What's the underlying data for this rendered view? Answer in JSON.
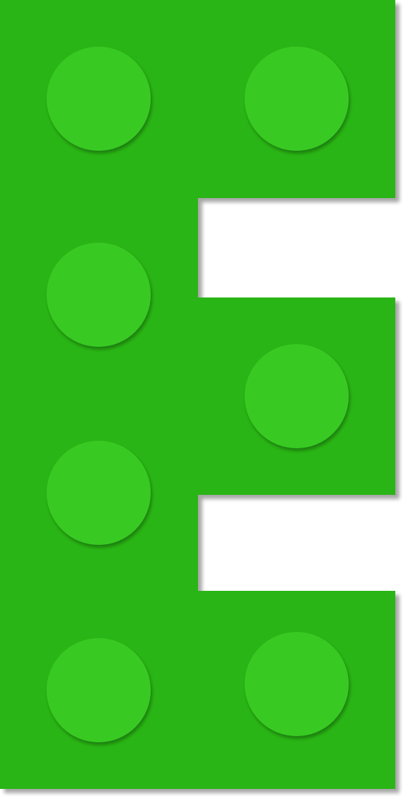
{
  "figure": {
    "kind": "brick-letter",
    "letter_shape": "E",
    "stud_count": 7,
    "colors": {
      "brick": "#2cb515",
      "stud": "#39ca23",
      "stud_shadow": "#1f8a0e",
      "drop_shadow": "#b8b8b8",
      "background": "#ffffff"
    }
  }
}
